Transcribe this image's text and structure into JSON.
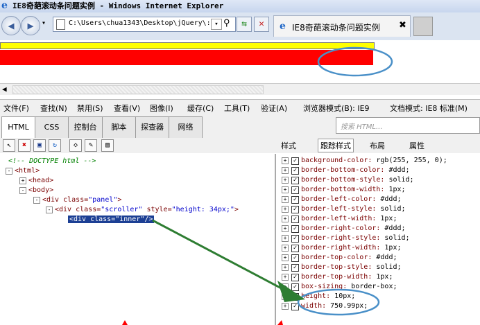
{
  "window": {
    "title": "IE8奇葩滚动条问题实例 - Windows Internet Explorer",
    "ie_icon_glyph": "e"
  },
  "address_bar": {
    "url": "C:\\Users\\chua1343\\Desktop\\jQuery\\:",
    "dropdown_glyph": "▾",
    "refresh_glyph": "⇆",
    "stop_glyph": "✕"
  },
  "tab": {
    "label": "IE8奇葩滚动条问题实例",
    "close_glyph": "✖"
  },
  "nav": {
    "back_glyph": "◀",
    "forward_glyph": "▶",
    "recent_glyph": "▾"
  },
  "page": {
    "yellow_color": "#ffff00",
    "red_color": "#ff0000"
  },
  "devtools": {
    "menu": [
      "文件(F)",
      "查找(N)",
      "禁用(S)",
      "查看(V)",
      "图像(I)",
      "缓存(C)",
      "工具(T)",
      "验证(A)",
      "浏览器模式(B): IE9",
      "文档模式: IE8 标准(M)"
    ],
    "tabs": [
      "HTML",
      "CSS",
      "控制台",
      "脚本",
      "探查器",
      "网络"
    ],
    "search_placeholder": "搜索 HTML...",
    "right_tabs": [
      "样式",
      "跟踪样式",
      "布局",
      "属性"
    ]
  },
  "dom_tree": {
    "comment": "<!-- DOCTYPE html -->",
    "html": "<html>",
    "head": "<head>",
    "body": "<body>",
    "panel_tag": "<div ",
    "panel_attr": "class=",
    "panel_val": "\"panel\"",
    "panel_end": ">",
    "scroller_tag": "<div ",
    "scroller_attr1": "class=",
    "scroller_val1": "\"scroller\"",
    "scroller_attr2": " style=",
    "scroller_val2": "\"height: 34px;\"",
    "scroller_end": ">",
    "inner": "<div class=\"inner\"/>"
  },
  "styles": [
    {
      "name": "background-color:",
      "value": " rgb(255, 255, 0);"
    },
    {
      "name": "border-bottom-color:",
      "value": " #ddd;"
    },
    {
      "name": "border-bottom-style:",
      "value": " solid;"
    },
    {
      "name": "border-bottom-width:",
      "value": " 1px;"
    },
    {
      "name": "border-left-color:",
      "value": " #ddd;"
    },
    {
      "name": "border-left-style:",
      "value": " solid;"
    },
    {
      "name": "border-left-width:",
      "value": " 1px;"
    },
    {
      "name": "border-right-color:",
      "value": " #ddd;"
    },
    {
      "name": "border-right-style:",
      "value": " solid;"
    },
    {
      "name": "border-right-width:",
      "value": " 1px;"
    },
    {
      "name": "border-top-color:",
      "value": " #ddd;"
    },
    {
      "name": "border-top-style:",
      "value": " solid;"
    },
    {
      "name": "border-top-width:",
      "value": " 1px;"
    },
    {
      "name": "box-sizing:",
      "value": " border-box;"
    },
    {
      "name": "height:",
      "value": " 10px;"
    },
    {
      "name": "width:",
      "value": " 750.99px;"
    }
  ],
  "annotation_colors": {
    "ellipse": "#4a90c8",
    "arrow": "#2e7d32"
  }
}
